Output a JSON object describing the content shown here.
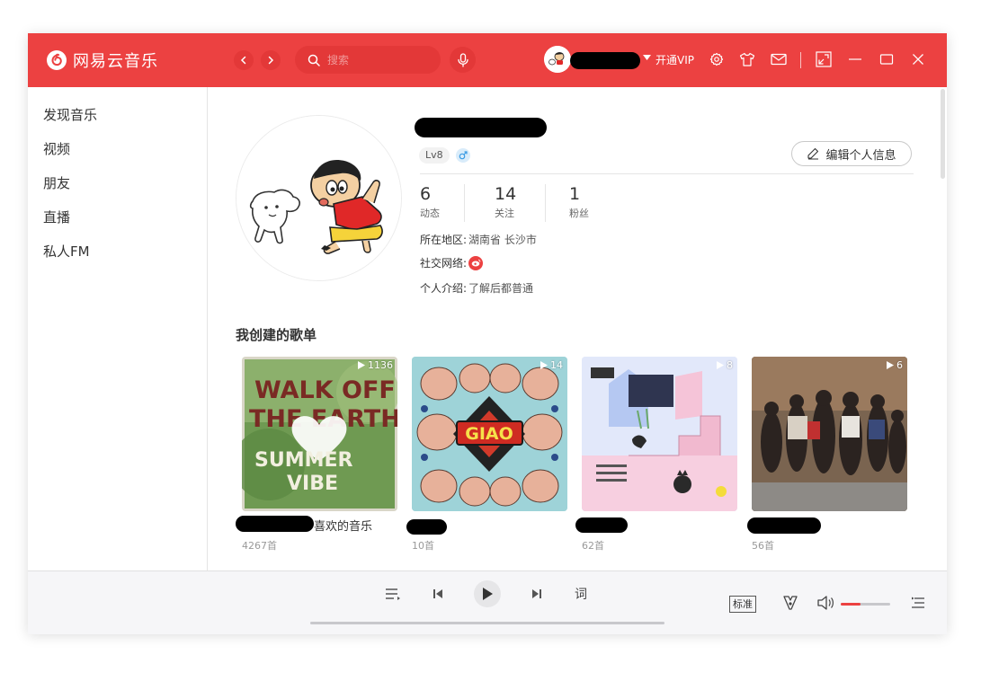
{
  "app": {
    "name": "网易云音乐"
  },
  "colors": {
    "brand": "#ec4141",
    "bg": "#ffffff",
    "player_bg": "#f6f6f8"
  },
  "search": {
    "placeholder": "搜索"
  },
  "titlebar": {
    "vip_label": "开通VIP",
    "icons": [
      "settings-gear-icon",
      "skin-shirt-icon",
      "mail-icon",
      "mini-mode-icon",
      "minimize-icon",
      "maximize-icon",
      "close-icon"
    ]
  },
  "sidebar": {
    "items": [
      {
        "label": "发现音乐"
      },
      {
        "label": "视频"
      },
      {
        "label": "朋友"
      },
      {
        "label": "直播"
      },
      {
        "label": "私人FM"
      }
    ]
  },
  "profile": {
    "level": "Lv8",
    "gender": "male",
    "edit_label": "编辑个人信息",
    "stats": [
      {
        "num": "6",
        "label": "动态"
      },
      {
        "num": "14",
        "label": "关注"
      },
      {
        "num": "1",
        "label": "粉丝"
      }
    ],
    "region_label": "所在地区:",
    "region_value": "湖南省 长沙市",
    "social_label": "社交网络:",
    "intro_label": "个人介绍:",
    "intro_value": "了解后都普通"
  },
  "playlists": {
    "section_title": "我创建的歌单",
    "items": [
      {
        "title": "喜欢的音乐",
        "plays": "1136",
        "count": "4267首",
        "cover_text": [
          "WALK OFF",
          "THE EARTH",
          "SUMMER",
          "VIBE"
        ]
      },
      {
        "title": "",
        "plays": "14",
        "count": "10首",
        "cover_text": [
          "GIAO"
        ]
      },
      {
        "title": "",
        "plays": "8",
        "count": "62首",
        "cover_text": []
      },
      {
        "title": "",
        "plays": "6",
        "count": "56首",
        "cover_text": []
      }
    ]
  },
  "player": {
    "lyrics_label": "词",
    "quality_label": "标准",
    "volume": 0.4
  }
}
